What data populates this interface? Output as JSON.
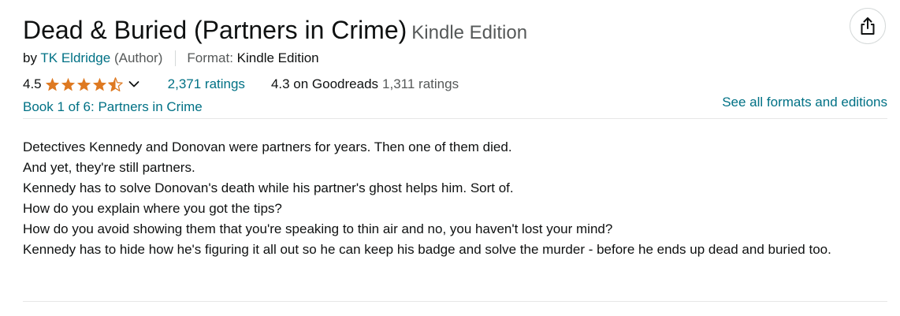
{
  "product": {
    "title": "Dead & Buried (Partners in Crime)",
    "edition": "Kindle Edition",
    "byline": {
      "by_prefix": "by",
      "author": "TK Eldridge",
      "author_role": "(Author)",
      "format_label": "Format:",
      "format_value": "Kindle Edition"
    },
    "rating": {
      "value": "4.5",
      "stars": 4.5,
      "ratings_count": "2,371 ratings",
      "goodreads_score": "4.3 on Goodreads",
      "goodreads_count": "1,311 ratings"
    },
    "series": "Book 1 of 6: Partners in Crime",
    "see_all_formats": "See all formats and editions",
    "description": [
      "Detectives Kennedy and Donovan were partners for years. Then one of them died.",
      "And yet, they're still partners.",
      "Kennedy has to solve Donovan's death while his partner's ghost helps him. Sort of.",
      "How do you explain where you got the tips?",
      "How do you avoid showing them that you're speaking to thin air and no, you haven't lost your mind?",
      "Kennedy has to hide how he's figuring it all out so he can keep his badge and solve the murder - before he ends up dead and buried too."
    ]
  },
  "icons": {
    "share": "share-icon",
    "star": "star-icon",
    "chevron": "chevron-down-icon"
  },
  "colors": {
    "link": "#007185",
    "star": "#de7921",
    "muted": "#565959",
    "text": "#0f1111"
  }
}
